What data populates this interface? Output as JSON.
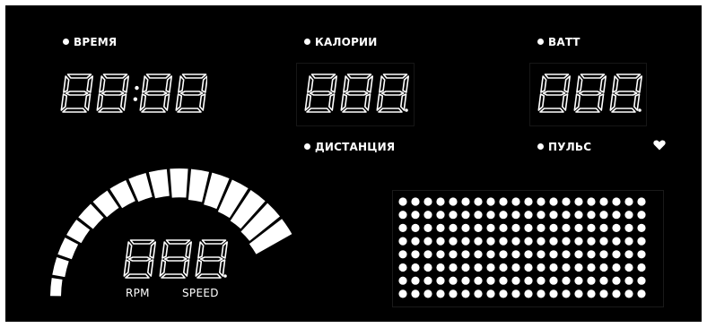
{
  "colors": {
    "panel": "#000000",
    "segment": "#ffffff",
    "page": "#ffffff"
  },
  "labels": {
    "time": "ВРЕМЯ",
    "calories": "КАЛОРИИ",
    "watt": "ВАТТ",
    "distance": "ДИСТАНЦИЯ",
    "pulse": "ПУЛЬС",
    "rpm": "RPM",
    "speed": "SPEED"
  },
  "displays": {
    "time": "88:88",
    "calories": "888.",
    "watt": "888.",
    "speed": "888."
  },
  "icons": {
    "heart": "heart-icon",
    "bullet": "bullet-dot-icon"
  },
  "matrix": {
    "rows": 8,
    "cols": 20
  },
  "gauge": {
    "segments": 16,
    "lit": 16
  }
}
